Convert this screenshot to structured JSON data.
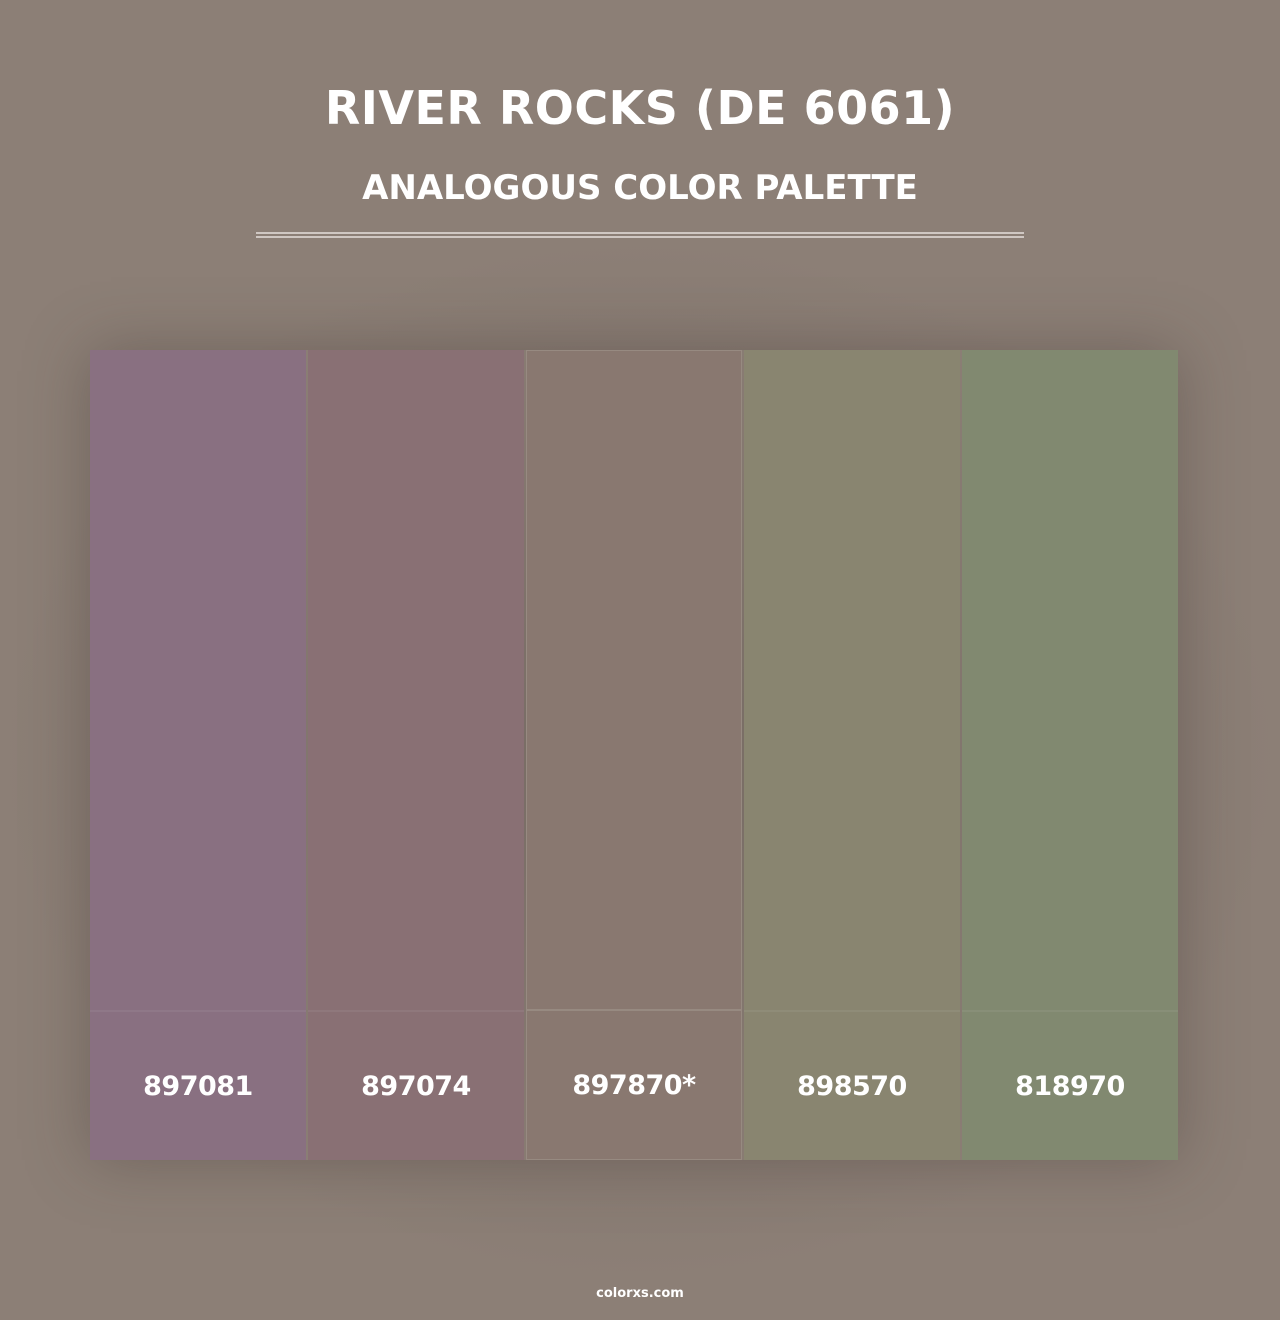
{
  "header": {
    "title": "RIVER ROCKS (DE 6061)",
    "subtitle": "ANALOGOUS COLOR PALETTE"
  },
  "colors": {
    "background": "#8c7f76",
    "text": "#ffffff"
  },
  "swatches": [
    {
      "code": "897081",
      "color": "#897081"
    },
    {
      "code": "897074",
      "color": "#897074"
    },
    {
      "code": "897870*",
      "color": "#897870"
    },
    {
      "code": "898570",
      "color": "#898570"
    },
    {
      "code": "818970",
      "color": "#818970"
    }
  ],
  "footer": {
    "site": "colorxs.com"
  }
}
